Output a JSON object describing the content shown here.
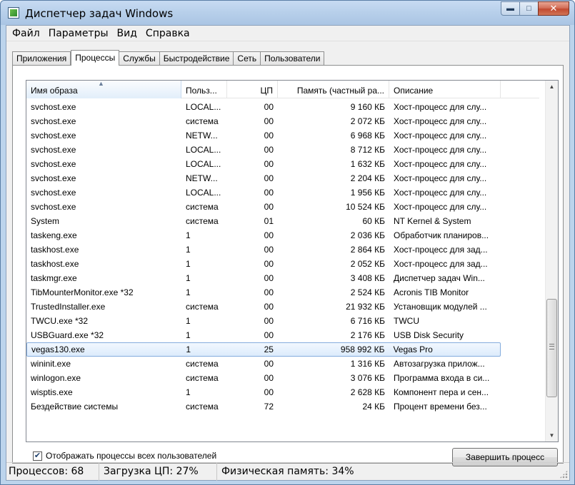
{
  "window": {
    "title": "Диспетчер задач Windows",
    "controls": {
      "minimize": "▬",
      "maximize": "□",
      "close": "✕"
    }
  },
  "menu": [
    "Файл",
    "Параметры",
    "Вид",
    "Справка"
  ],
  "tabs": [
    "Приложения",
    "Процессы",
    "Службы",
    "Быстродействие",
    "Сеть",
    "Пользователи"
  ],
  "active_tab": "Процессы",
  "columns": {
    "name": "Имя образа",
    "user": "Польз...",
    "cpu": "ЦП",
    "mem": "Память (частный ра...",
    "desc": "Описание"
  },
  "sort_indicator": "▲",
  "processes": [
    {
      "name": "svchost.exe",
      "user": "LOCAL...",
      "cpu": "00",
      "mem": "9 160 КБ",
      "desc": "Хост-процесс для слу..."
    },
    {
      "name": "svchost.exe",
      "user": "система",
      "cpu": "00",
      "mem": "2 072 КБ",
      "desc": "Хост-процесс для слу..."
    },
    {
      "name": "svchost.exe",
      "user": "NETW...",
      "cpu": "00",
      "mem": "6 968 КБ",
      "desc": "Хост-процесс для слу..."
    },
    {
      "name": "svchost.exe",
      "user": "LOCAL...",
      "cpu": "00",
      "mem": "8 712 КБ",
      "desc": "Хост-процесс для слу..."
    },
    {
      "name": "svchost.exe",
      "user": "LOCAL...",
      "cpu": "00",
      "mem": "1 632 КБ",
      "desc": "Хост-процесс для слу..."
    },
    {
      "name": "svchost.exe",
      "user": "NETW...",
      "cpu": "00",
      "mem": "2 204 КБ",
      "desc": "Хост-процесс для слу..."
    },
    {
      "name": "svchost.exe",
      "user": "LOCAL...",
      "cpu": "00",
      "mem": "1 956 КБ",
      "desc": "Хост-процесс для слу..."
    },
    {
      "name": "svchost.exe",
      "user": "система",
      "cpu": "00",
      "mem": "10 524 КБ",
      "desc": "Хост-процесс для слу..."
    },
    {
      "name": "System",
      "user": "система",
      "cpu": "01",
      "mem": "60 КБ",
      "desc": "NT Kernel & System"
    },
    {
      "name": "taskeng.exe",
      "user": "1",
      "cpu": "00",
      "mem": "2 036 КБ",
      "desc": "Обработчик планиров..."
    },
    {
      "name": "taskhost.exe",
      "user": "1",
      "cpu": "00",
      "mem": "2 864 КБ",
      "desc": "Хост-процесс для зад..."
    },
    {
      "name": "taskhost.exe",
      "user": "1",
      "cpu": "00",
      "mem": "2 052 КБ",
      "desc": "Хост-процесс для зад..."
    },
    {
      "name": "taskmgr.exe",
      "user": "1",
      "cpu": "00",
      "mem": "3 408 КБ",
      "desc": "Диспетчер задач Win..."
    },
    {
      "name": "TibMounterMonitor.exe *32",
      "user": "1",
      "cpu": "00",
      "mem": "2 524 КБ",
      "desc": "Acronis TIB Monitor"
    },
    {
      "name": "TrustedInstaller.exe",
      "user": "система",
      "cpu": "00",
      "mem": "21 932 КБ",
      "desc": "Установщик модулей ..."
    },
    {
      "name": "TWCU.exe *32",
      "user": "1",
      "cpu": "00",
      "mem": "6 716 КБ",
      "desc": "TWCU"
    },
    {
      "name": "USBGuard.exe *32",
      "user": "1",
      "cpu": "00",
      "mem": "2 176 КБ",
      "desc": "USB Disk Security"
    },
    {
      "name": "vegas130.exe",
      "user": "1",
      "cpu": "25",
      "mem": "958 992 КБ",
      "desc": "Vegas Pro",
      "selected": true
    },
    {
      "name": "wininit.exe",
      "user": "система",
      "cpu": "00",
      "mem": "1 316 КБ",
      "desc": "Автозагрузка прилож..."
    },
    {
      "name": "winlogon.exe",
      "user": "система",
      "cpu": "00",
      "mem": "3 076 КБ",
      "desc": "Программа входа в си..."
    },
    {
      "name": "wisptis.exe",
      "user": "1",
      "cpu": "00",
      "mem": "2 628 КБ",
      "desc": "Компонент пера и сен..."
    },
    {
      "name": "Бездействие системы",
      "user": "система",
      "cpu": "72",
      "mem": "24 КБ",
      "desc": "Процент времени без..."
    }
  ],
  "show_all_users": {
    "label": "Отображать процессы всех пользователей",
    "checked": true,
    "mark": "✔"
  },
  "end_process_label": "Завершить процесс",
  "status": {
    "processes": "Процессов: 68",
    "cpu": "Загрузка ЦП: 27%",
    "memory": "Физическая память: 34%"
  }
}
